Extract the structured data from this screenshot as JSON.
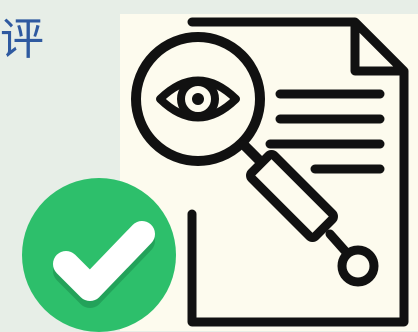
{
  "heading": {
    "text": "评"
  },
  "icons": {
    "document": "document-review-icon",
    "magnifier": "magnifying-eye-icon",
    "check": "checkmark-badge-icon"
  },
  "colors": {
    "background": "#e7eee7",
    "card": "#fdfbee",
    "heading": "#2f5aa0",
    "stroke": "#111111",
    "badge": "#2dbf6b",
    "badge_shadow": "#23a25a",
    "check": "#ffffff"
  }
}
